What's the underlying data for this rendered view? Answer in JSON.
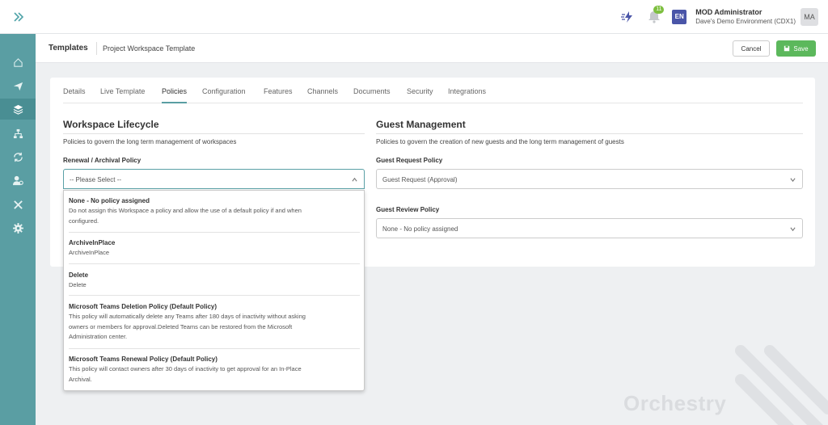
{
  "topbar": {
    "expand_icon": "chevron-double-right-icon",
    "notification_count": "11",
    "language": "EN",
    "user_name": "MOD Administrator",
    "user_environment": "Dave's Demo Environment (CDX1)",
    "avatar_initials": "MA"
  },
  "sidebar": {
    "items": [
      "home-icon",
      "send-icon",
      "layers-icon",
      "hierarchy-icon",
      "sync-icon",
      "user-settings-icon",
      "tools-icon",
      "gear-icon"
    ],
    "active_index": 2
  },
  "header": {
    "breadcrumb_main": "Templates",
    "breadcrumb_sub": "Project Workspace Template",
    "cancel_label": "Cancel",
    "save_label": "Save"
  },
  "tabs": [
    "Details",
    "Live Template",
    "Policies",
    "Configuration",
    "Features",
    "Channels",
    "Documents",
    "Security",
    "Integrations"
  ],
  "active_tab": "Policies",
  "workspace_lifecycle": {
    "title": "Workspace Lifecycle",
    "description": "Policies to govern the long term management of workspaces",
    "renewal_label": "Renewal / Archival Policy",
    "renewal_value": "-- Please Select --"
  },
  "guest_management": {
    "title": "Guest Management",
    "description": "Policies to govern the creation of new guests and the long term management of guests",
    "request_label": "Guest Request Policy",
    "request_value": "Guest Request (Approval)",
    "review_label": "Guest Review Policy",
    "review_value": "None - No policy assigned"
  },
  "dropdown_options": [
    {
      "title": "None - No policy assigned",
      "desc": [
        "Do not assign this Workspace a policy and allow the use of a default policy if and when",
        "configured."
      ]
    },
    {
      "title": "ArchiveInPlace",
      "desc": [
        "ArchiveInPlace"
      ]
    },
    {
      "title": "Delete",
      "desc": [
        "Delete"
      ]
    },
    {
      "title": "Microsoft Teams Deletion Policy (Default Policy)",
      "desc": [
        "This policy will automatically delete any Teams after 180 days of inactivity without asking",
        "owners or members for approval.Deleted Teams can be restored from the Microsoft",
        "Administration center."
      ]
    },
    {
      "title": "Microsoft Teams Renewal Policy (Default Policy)",
      "desc": [
        "This policy will contact owners after 30 days of inactivity to get approval for an In-Place",
        "Archival."
      ]
    }
  ],
  "watermark": "Orchestry",
  "colors": {
    "sidebar": "#5a9ea3",
    "save": "#5cb85c",
    "accent": "#5a9ea3",
    "lang_badge": "#4a55a8",
    "notif_badge": "#7dbf3f"
  }
}
